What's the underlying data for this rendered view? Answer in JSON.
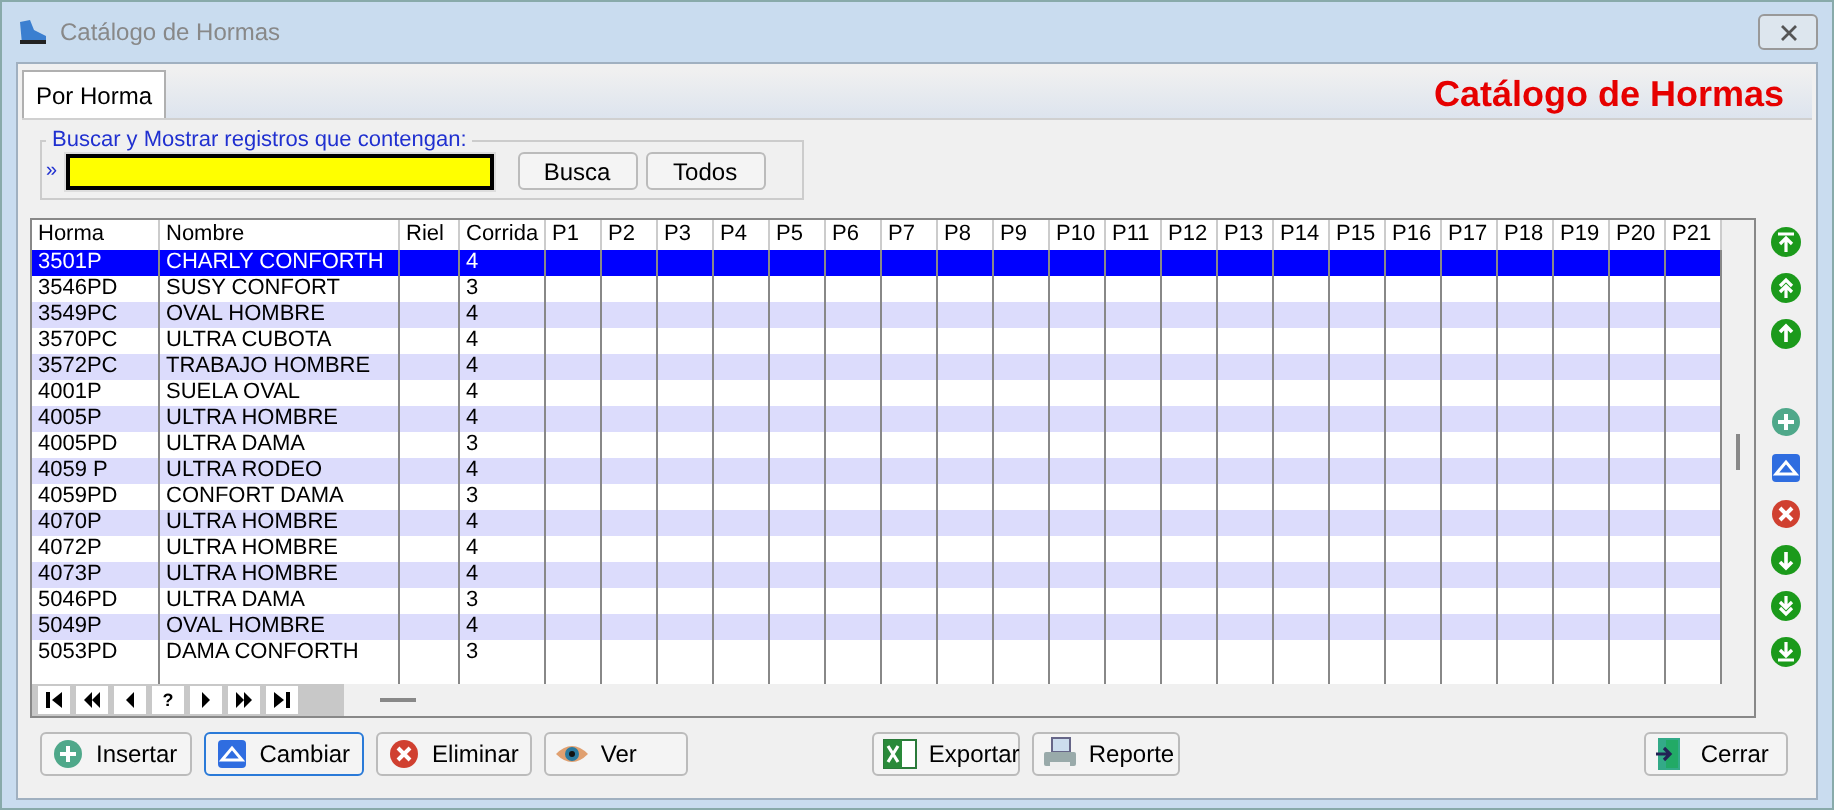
{
  "window": {
    "title": "Catálogo de  Hormas"
  },
  "tabs": [
    {
      "label": "Por Horma",
      "selected": true
    }
  ],
  "heading": "Catálogo de Hormas",
  "search": {
    "legend": "Buscar y Mostrar registros que contengan:",
    "prompt": "»",
    "buttons": [
      "Busca",
      "Todos"
    ]
  },
  "table": {
    "columns": [
      "Horma",
      "Nombre",
      "Riel",
      "Corrida",
      "P1",
      "P2",
      "P3",
      "P4",
      "P5",
      "P6",
      "P7",
      "P8",
      "P9",
      "P10",
      "P11",
      "P12",
      "P13",
      "P14",
      "P15",
      "P16",
      "P17",
      "P18",
      "P19",
      "P20",
      "P21"
    ],
    "rows": [
      {
        "horma": "3501P",
        "nombre": "CHARLY CONFORTH",
        "corrida": "4",
        "selected": true
      },
      {
        "horma": "3546PD",
        "nombre": "SUSY CONFORT",
        "corrida": "3",
        "selected": false
      },
      {
        "horma": "3549PC",
        "nombre": "OVAL HOMBRE",
        "corrida": "4",
        "selected": false
      },
      {
        "horma": "3570PC",
        "nombre": "ULTRA CUBOTA",
        "corrida": "4",
        "selected": false
      },
      {
        "horma": "3572PC",
        "nombre": "TRABAJO HOMBRE",
        "corrida": "4",
        "selected": false
      },
      {
        "horma": "4001P",
        "nombre": "SUELA OVAL",
        "corrida": "4",
        "selected": false
      },
      {
        "horma": "4005P",
        "nombre": "ULTRA HOMBRE",
        "corrida": "4",
        "selected": false
      },
      {
        "horma": "4005PD",
        "nombre": "ULTRA DAMA",
        "corrida": "3",
        "selected": false
      },
      {
        "horma": "4059 P",
        "nombre": "ULTRA RODEO",
        "corrida": "4",
        "selected": false
      },
      {
        "horma": "4059PD",
        "nombre": "CONFORT DAMA",
        "corrida": "3",
        "selected": false
      },
      {
        "horma": "4070P",
        "nombre": "ULTRA HOMBRE",
        "corrida": "4",
        "selected": false
      },
      {
        "horma": "4072P",
        "nombre": "ULTRA HOMBRE",
        "corrida": "4",
        "selected": false
      },
      {
        "horma": "4073P",
        "nombre": "ULTRA HOMBRE",
        "corrida": "4",
        "selected": false
      },
      {
        "horma": "5046PD",
        "nombre": "ULTRA DAMA",
        "corrida": "3",
        "selected": false
      },
      {
        "horma": "5049P",
        "nombre": "OVAL HOMBRE",
        "corrida": "4",
        "selected": false
      },
      {
        "horma": "5053PD",
        "nombre": "DAMA CONFORTH",
        "corrida": "3",
        "selected": false
      }
    ],
    "navigator": [
      {
        "kind": "first"
      },
      {
        "kind": "prev-page"
      },
      {
        "kind": "prev"
      },
      {
        "kind": "text",
        "label": "?"
      },
      {
        "kind": "next"
      },
      {
        "kind": "next-page"
      },
      {
        "kind": "last"
      }
    ]
  },
  "side_buttons": [
    {
      "kind": "top"
    },
    {
      "kind": "page-up"
    },
    {
      "kind": "up"
    },
    {
      "kind": "gap"
    },
    {
      "kind": "add"
    },
    {
      "kind": "edit"
    },
    {
      "kind": "delete"
    },
    {
      "kind": "down"
    },
    {
      "kind": "page-down"
    },
    {
      "kind": "bottom"
    }
  ],
  "actions": [
    {
      "kind": "add",
      "label": "Insertar",
      "selected": false
    },
    {
      "kind": "edit",
      "label": "Cambiar",
      "selected": true
    },
    {
      "kind": "delete",
      "label": "Eliminar",
      "selected": false
    },
    {
      "kind": "view",
      "label": "Ver",
      "selected": false
    },
    {
      "kind": "excel",
      "label": "Exportar",
      "selected": false
    },
    {
      "kind": "print",
      "label": "Reporte",
      "selected": false
    },
    {
      "kind": "exit",
      "label": "Cerrar",
      "selected": false
    }
  ]
}
